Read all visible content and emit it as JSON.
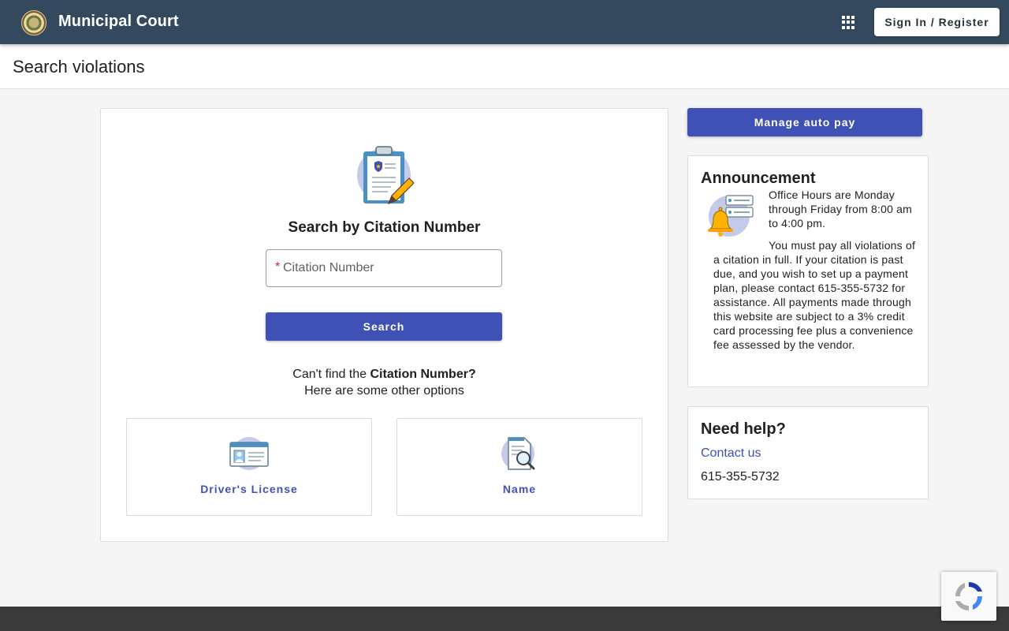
{
  "header": {
    "title": "Municipal Court",
    "signin_label": "Sign In / Register"
  },
  "page": {
    "title": "Search violations"
  },
  "search": {
    "heading": "Search by Citation Number",
    "required_marker": "*",
    "citation_placeholder": "Citation Number",
    "citation_value": "",
    "button_label": "Search",
    "cant_find_prefix": "Can't find the ",
    "cant_find_bold": "Citation Number?",
    "other_options": "Here are some other options"
  },
  "options": [
    {
      "label": "Driver's License",
      "icon": "id-card-icon"
    },
    {
      "label": "Name",
      "icon": "document-search-icon"
    }
  ],
  "sidebar": {
    "autopay_label": "Manage auto pay",
    "announcement": {
      "title": "Announcement",
      "paragraph1": "Office Hours are Monday through Friday from 8:00 am to 4:00 pm.",
      "paragraph2": "You must pay all violations of a citation in full. If your citation is past due, and you wish to set up a payment plan, please contact 615-355-5732 for assistance.  All payments made through this website are subject to a 3% credit card processing fee plus a convenience fee assessed by the vendor."
    },
    "help": {
      "title": "Need help?",
      "contact_label": "Contact us",
      "phone": "615-355-5732"
    }
  },
  "colors": {
    "header_bg": "#34495e",
    "primary": "#3f51b5",
    "footer_bg": "#3a3a3a"
  }
}
